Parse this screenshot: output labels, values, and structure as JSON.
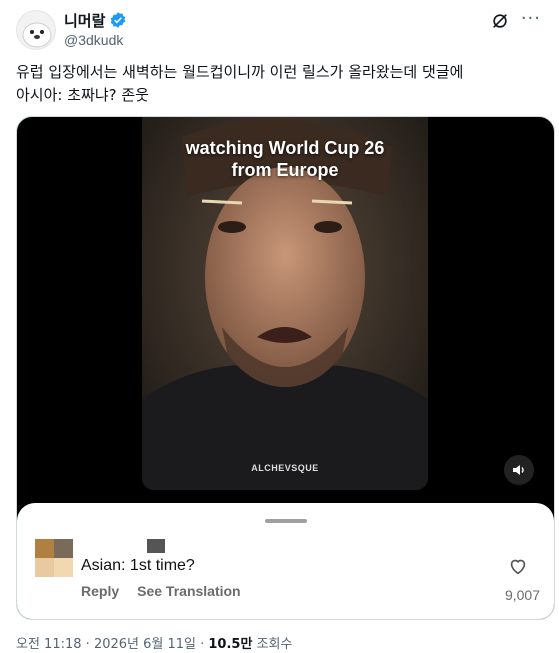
{
  "post": {
    "display_name": "니머랄",
    "handle": "@3dkudk",
    "text": "유럽 입장에서는 새벽하는 월드컵이니까 이런 릴스가 올라왔는데 댓글에\n아시아: 초짜냐? 존웃"
  },
  "video": {
    "caption": "watching World Cup 26\nfrom Europe",
    "shirt_brand": "ALCHEVSQUE"
  },
  "comment": {
    "text": "Asian: 1st time?",
    "reply_label": "Reply",
    "translate_label": "See Translation",
    "like_count": "9,007"
  },
  "meta": {
    "time": "오전 11:18",
    "date": "2026년 6월 11일",
    "views": "10.5만",
    "views_label": "조회수"
  },
  "colors": {
    "verified_blue": "#1d9bf0",
    "secondary_text": "#536471"
  }
}
